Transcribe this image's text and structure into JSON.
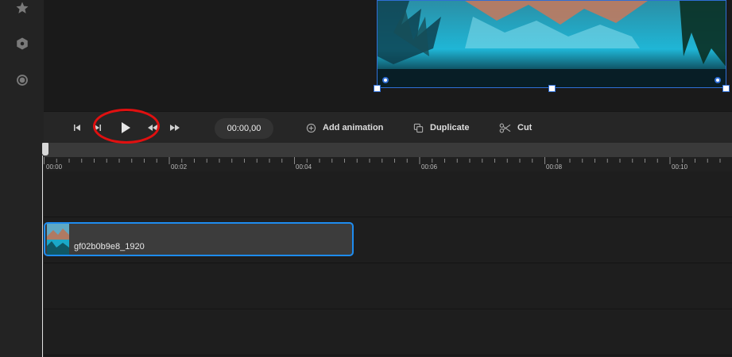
{
  "sidebar": {
    "items": [
      {
        "icon": "star-icon"
      },
      {
        "icon": "hexagon-icon"
      },
      {
        "icon": "record-icon"
      }
    ]
  },
  "toolbar": {
    "time": "00:00,00",
    "add_animation": "Add animation",
    "duplicate": "Duplicate",
    "cut": "Cut",
    "accent": "#2f6fd6"
  },
  "ruler": {
    "labels": [
      "00:00",
      "00:02",
      "00:04",
      "00:06",
      "00:08",
      "00:10"
    ]
  },
  "clip": {
    "name": "gf02b0b9e8_1920",
    "border_color": "#1e8cf0"
  },
  "annotation_color": "#e01010"
}
